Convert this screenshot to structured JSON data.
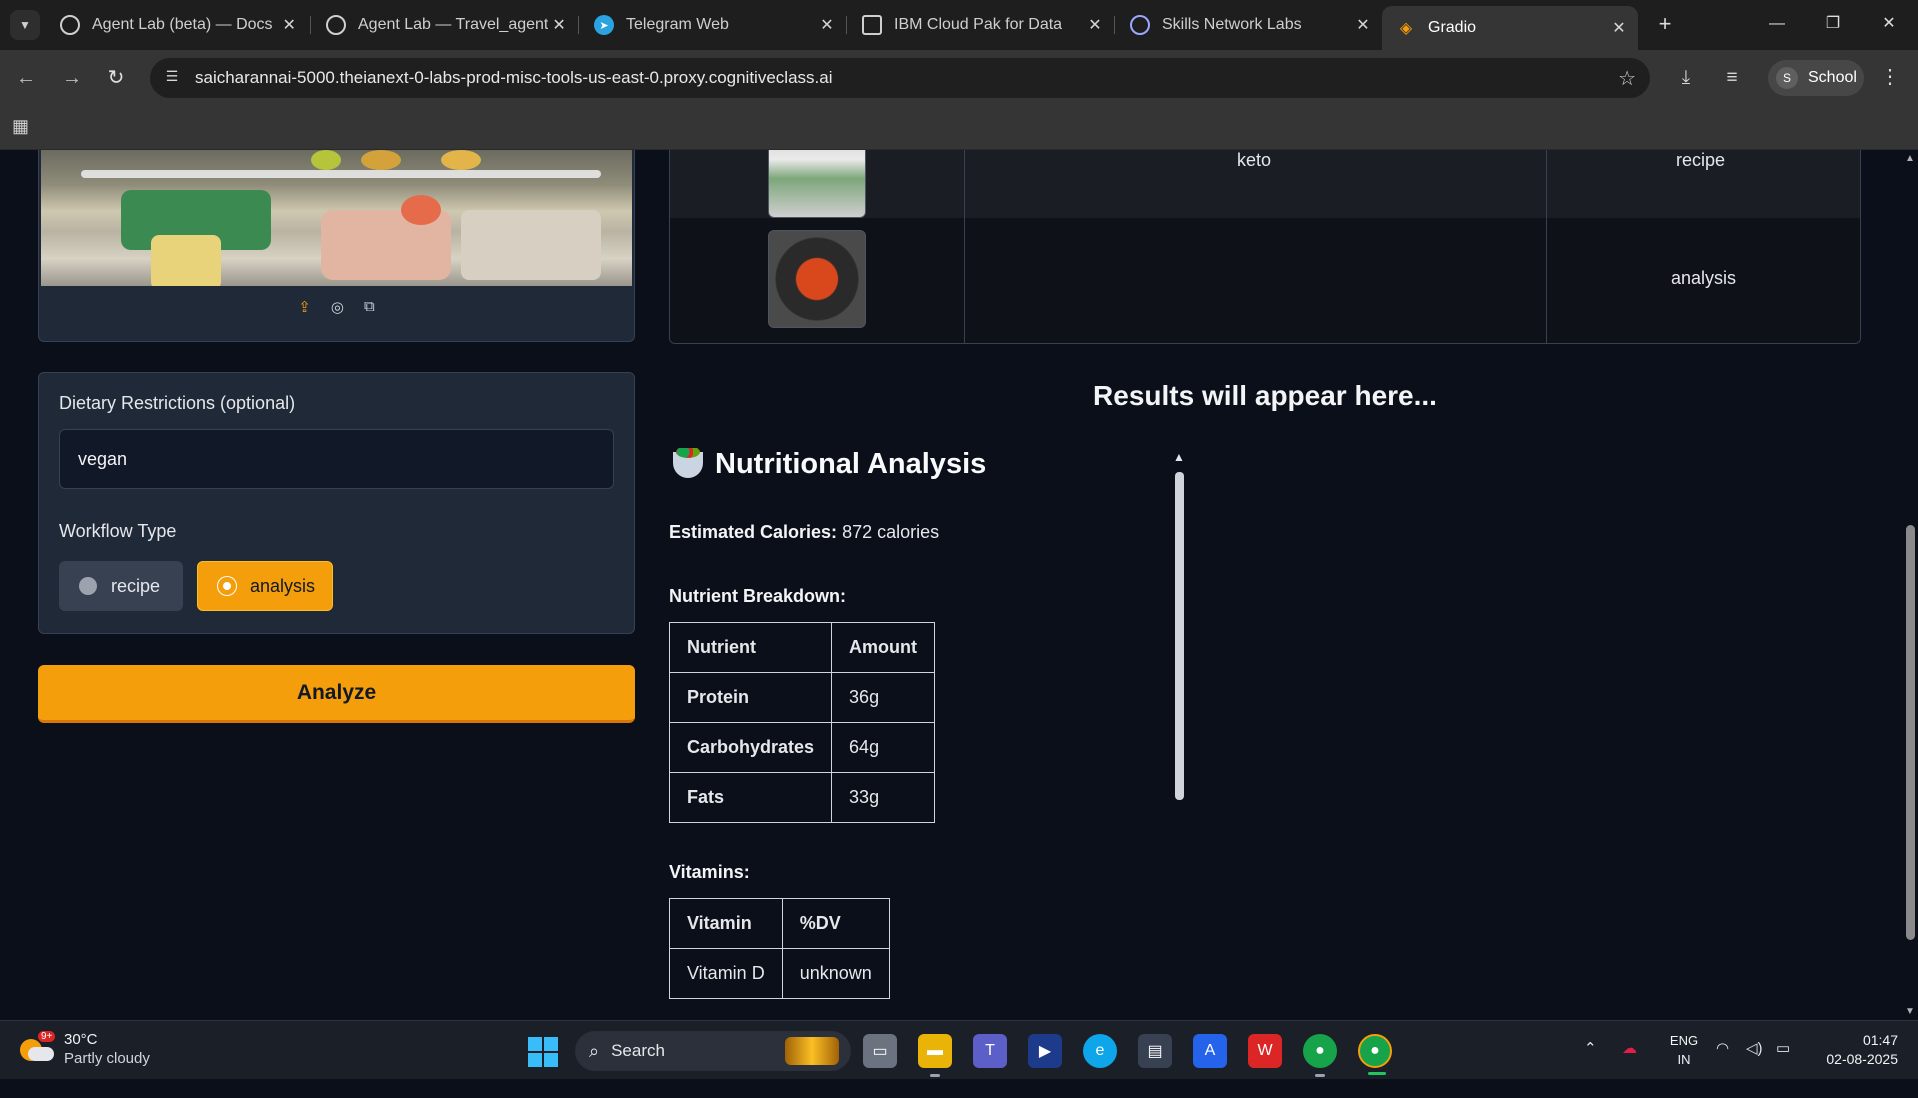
{
  "browser": {
    "tabs": [
      {
        "title": "Agent Lab (beta) — Docs |",
        "active": false
      },
      {
        "title": "Agent Lab — Travel_agent",
        "active": false
      },
      {
        "title": "Telegram Web",
        "active": false
      },
      {
        "title": "IBM Cloud Pak for Data",
        "active": false
      },
      {
        "title": "Skills Network Labs",
        "active": false
      },
      {
        "title": "Gradio",
        "active": true
      }
    ],
    "url": "saicharannai-5000.theianext-0-labs-prod-misc-tools-us-east-0.proxy.cognitiveclass.ai",
    "profile_initial": "S",
    "profile_name": "School"
  },
  "app": {
    "form": {
      "dietary_label": "Dietary Restrictions (optional)",
      "dietary_value": "vegan",
      "workflow_label": "Workflow Type",
      "workflow_options": [
        "recipe",
        "analysis"
      ],
      "workflow_selected": "analysis",
      "analyze_button": "Analyze"
    },
    "examples": [
      {
        "image": "fridge",
        "dietary": "keto",
        "workflow": "recipe"
      },
      {
        "image": "dish",
        "dietary": "",
        "workflow": "analysis"
      }
    ],
    "results_title": "Results will appear here...",
    "nutrition": {
      "heading": "Nutritional Analysis",
      "calories_label": "Estimated Calories:",
      "calories_value": "872 calories",
      "breakdown_label": "Nutrient Breakdown:",
      "nutrient_headers": [
        "Nutrient",
        "Amount"
      ],
      "nutrients": [
        [
          "Protein",
          "36g"
        ],
        [
          "Carbohydrates",
          "64g"
        ],
        [
          "Fats",
          "33g"
        ]
      ],
      "vitamins_label": "Vitamins:",
      "vitamin_headers": [
        "Vitamin",
        "%DV"
      ],
      "vitamins": [
        [
          "Vitamin D",
          "unknown"
        ]
      ]
    },
    "colors": {
      "accent": "#f59e0b",
      "background": "#0b0f19",
      "panel": "#1f2937"
    }
  },
  "taskbar": {
    "weather_temp": "30°C",
    "weather_desc": "Partly cloudy",
    "weather_badge": "9+",
    "search_label": "Search",
    "lang_line1": "ENG",
    "lang_line2": "IN",
    "time": "01:47",
    "date": "02-08-2025"
  }
}
